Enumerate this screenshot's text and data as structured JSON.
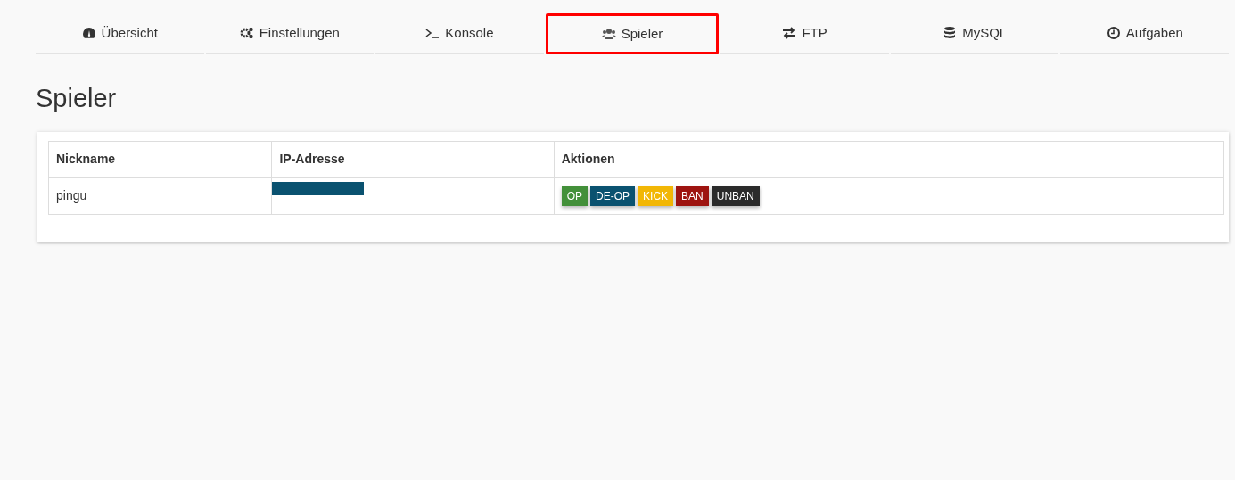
{
  "tabs": [
    {
      "label": "Übersicht",
      "selected": false
    },
    {
      "label": "Einstellungen",
      "selected": false
    },
    {
      "label": "Konsole",
      "selected": false
    },
    {
      "label": "Spieler",
      "selected": true
    },
    {
      "label": "FTP",
      "selected": false
    },
    {
      "label": "MySQL",
      "selected": false
    },
    {
      "label": "Aufgaben",
      "selected": false
    }
  ],
  "heading": "Spieler",
  "table": {
    "columns": [
      "Nickname",
      "IP-Adresse",
      "Aktionen"
    ],
    "rows": [
      {
        "nickname": "pingu",
        "ip_redacted": true,
        "actions": [
          {
            "label": "OP",
            "color": "#43903a"
          },
          {
            "label": "DE-OP",
            "color": "#0a5270"
          },
          {
            "label": "KICK",
            "color": "#f2b705"
          },
          {
            "label": "BAN",
            "color": "#9e1410"
          },
          {
            "label": "UNBAN",
            "color": "#2b2b2b"
          }
        ]
      }
    ]
  }
}
